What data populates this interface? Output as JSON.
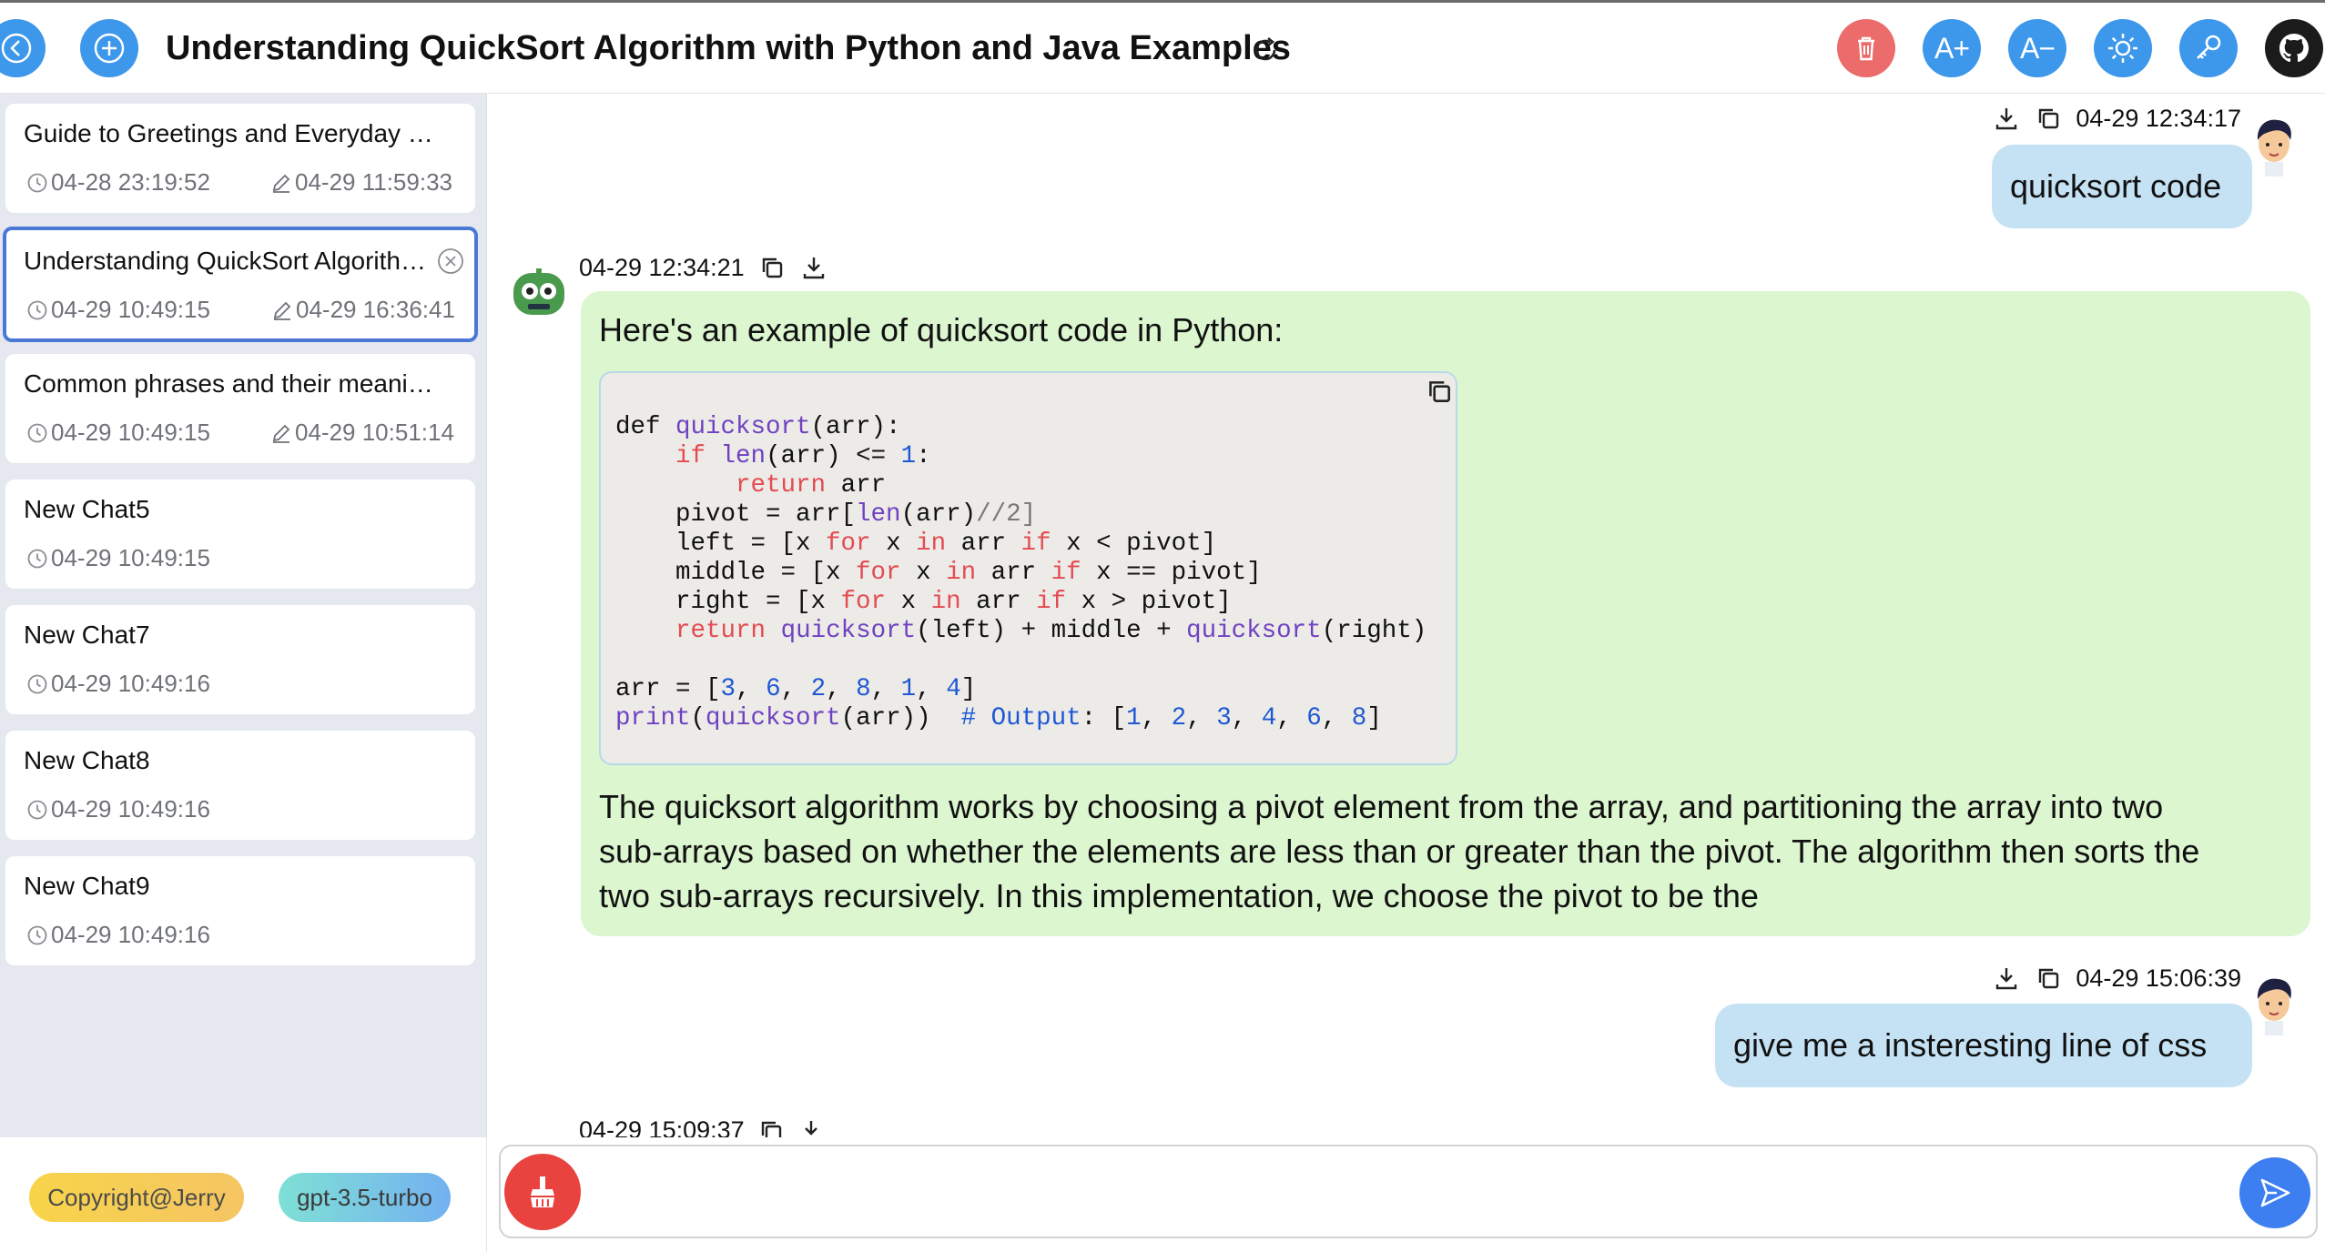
{
  "header": {
    "title": "Understanding QuickSort Algorithm with Python and Java Examples",
    "font_increase_label": "A+",
    "font_decrease_label": "A−"
  },
  "colors": {
    "accent": "#3d97ea",
    "delete": "#ec6b6b",
    "bot_bubble": "#dcf6d0",
    "user_bubble": "#c5e2f5",
    "active_border": "#4b78d6"
  },
  "sidebar": {
    "chats": [
      {
        "title": "Guide to Greetings and Everyday …",
        "created": "04-28 23:19:52",
        "edited": "04-29 11:59:33"
      },
      {
        "title": "Understanding QuickSort Algorith…",
        "created": "04-29 10:49:15",
        "edited": "04-29 16:36:41"
      },
      {
        "title": "Common phrases and their meani…",
        "created": "04-29 10:49:15",
        "edited": "04-29 10:51:14"
      },
      {
        "title": "New Chat5",
        "created": "04-29 10:49:15"
      },
      {
        "title": "New Chat7",
        "created": "04-29 10:49:16"
      },
      {
        "title": "New Chat8",
        "created": "04-29 10:49:16"
      },
      {
        "title": "New Chat9",
        "created": "04-29 10:49:16"
      }
    ],
    "footer": {
      "copyright": "Copyright@Jerry",
      "model": "gpt-3.5-turbo"
    }
  },
  "messages": [
    {
      "role": "user",
      "time": "04-29 12:34:17",
      "text": "quicksort code"
    },
    {
      "role": "assistant",
      "time": "04-29 12:34:21",
      "intro": "Here's an example of quicksort code in Python:",
      "paragraph_lines": [
        "The quicksort algorithm works by choosing a pivot element from the array, and partitioning the array into two",
        "sub-arrays based on whether the elements are less than or greater than the pivot. The algorithm then sorts the",
        "two sub-arrays recursively. In this implementation, we choose the pivot to be the"
      ]
    },
    {
      "role": "user",
      "time": "04-29 15:06:39",
      "text": "give me a insteresting line of css"
    },
    {
      "role": "assistant",
      "time": "04-29 15:09:37"
    }
  ],
  "composer": {
    "placeholder": ""
  }
}
